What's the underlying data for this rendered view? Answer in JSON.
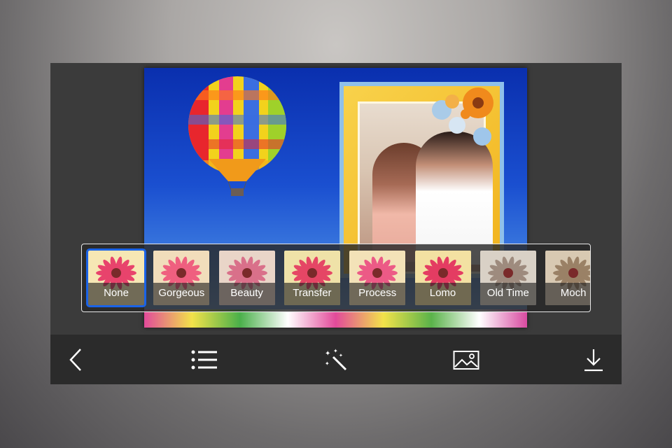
{
  "filters": [
    {
      "label": "None",
      "tint": "#f6e7b4",
      "petal": "#e8436c",
      "selected": true
    },
    {
      "label": "Gorgeous",
      "tint": "#f1ddbb",
      "petal": "#ef5f7f",
      "selected": false
    },
    {
      "label": "Beauty",
      "tint": "#e9d5c8",
      "petal": "#d9708a",
      "selected": false
    },
    {
      "label": "Transfer",
      "tint": "#efe2a8",
      "petal": "#e54665",
      "selected": false
    },
    {
      "label": "Process",
      "tint": "#f3e2b8",
      "petal": "#ec5a86",
      "selected": false
    },
    {
      "label": "Lomo",
      "tint": "#f3e1a2",
      "petal": "#e43c62",
      "selected": false
    },
    {
      "label": "Old Time",
      "tint": "#d9d1c6",
      "petal": "#9e8b7e",
      "selected": false
    },
    {
      "label": "Moch",
      "tint": "#d8c9b2",
      "petal": "#9a8166",
      "selected": false
    }
  ],
  "toolbar": {
    "back": "back-icon",
    "list": "list-icon",
    "effects": "magic-wand-icon",
    "gallery": "image-icon",
    "download": "download-icon"
  },
  "colors": {
    "panel": "#3b3b3b",
    "toolbar": "#2b2b2b",
    "selection": "#1a63e8"
  }
}
